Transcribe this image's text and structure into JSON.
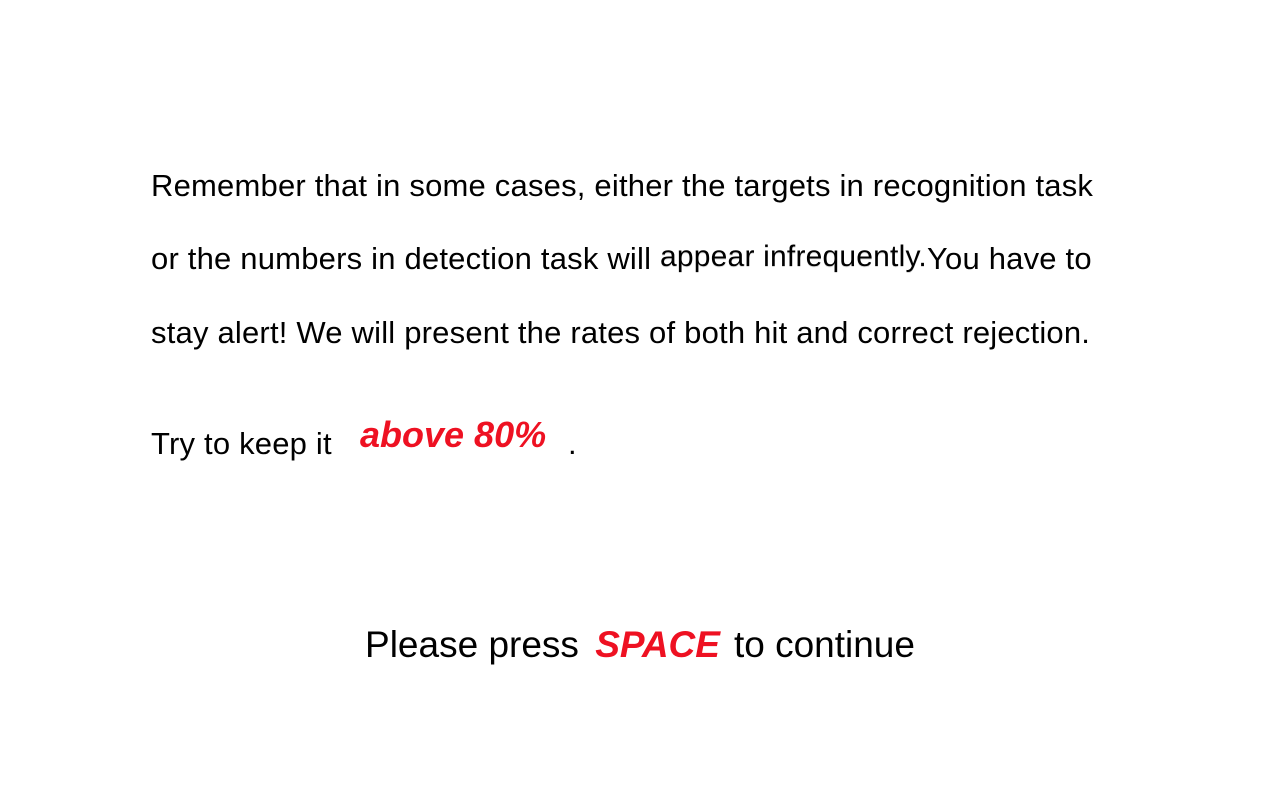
{
  "instructions": {
    "line1": "Remember that in some cases, either the targets in recognition task",
    "line2_before": "or the numbers in detection task will ",
    "line2_emphasis": "appear infrequently.",
    "line2_after": "You have to",
    "line3": "stay alert! We will present the rates of both hit and correct rejection.",
    "keep_prefix": "Try to keep it",
    "keep_highlight": "above 80%",
    "keep_suffix": "."
  },
  "prompt": {
    "before": "Please press",
    "key": "SPACE",
    "after": "to continue"
  },
  "colors": {
    "background": "#ffffff",
    "text": "#000000",
    "highlight": "#ee1122"
  }
}
